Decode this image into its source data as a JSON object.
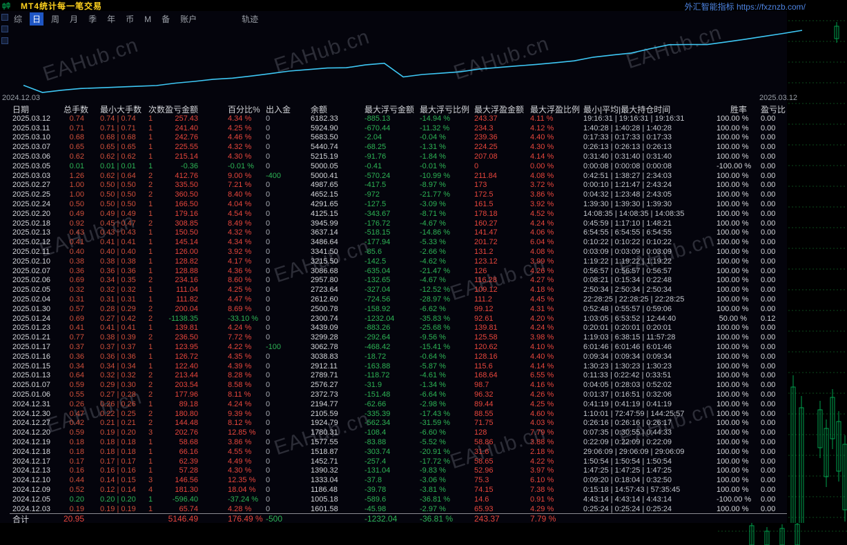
{
  "titlebar": {
    "title": "MT4统计每一笔交易",
    "right_text": "外汇智能指标 https://fxznzb.com/"
  },
  "menu": {
    "items": [
      "综",
      "日",
      "周",
      "月",
      "季",
      "年",
      "币",
      "M",
      "备",
      "账户",
      "轨迹"
    ],
    "active_index": 1
  },
  "watermark_text": "EAHub.cn",
  "equity_chart": {
    "start_date": "2024.12.03",
    "end_date": "2025.03.12"
  },
  "chart_data": {
    "type": "line",
    "title": "账户余额曲线",
    "line_color": "#3ec8f5",
    "x_range": [
      "2024.12.03",
      "2025.03.12"
    ],
    "ylim": [
      1005.18,
      6182.33
    ],
    "grid": false,
    "x": [
      "2024.12.03",
      "2024.12.05",
      "2024.12.09",
      "2024.12.10",
      "2024.12.13",
      "2024.12.17",
      "2024.12.18",
      "2024.12.19",
      "2024.12.20",
      "2024.12.27",
      "2024.12.30",
      "2024.12.31",
      "2025.01.06",
      "2025.01.07",
      "2025.01.13",
      "2025.01.15",
      "2025.01.16",
      "2025.01.17",
      "2025.01.21",
      "2025.01.23",
      "2025.01.24",
      "2025.01.30",
      "2025.02.04",
      "2025.02.05",
      "2025.02.06",
      "2025.02.07",
      "2025.02.10",
      "2025.02.11",
      "2025.02.12",
      "2025.02.13",
      "2025.02.18",
      "2025.02.20",
      "2025.02.24",
      "2025.02.25",
      "2025.02.27",
      "2025.03.03",
      "2025.03.05",
      "2025.03.06",
      "2025.03.07",
      "2025.03.10",
      "2025.03.11",
      "2025.03.12"
    ],
    "series": [
      {
        "name": "余额",
        "values": [
          1601.58,
          1005.18,
          1186.48,
          1333.04,
          1390.32,
          1452.71,
          1518.87,
          1577.55,
          1780.31,
          1924.79,
          2105.59,
          2194.77,
          2372.73,
          2576.27,
          2789.71,
          2912.11,
          3038.83,
          3062.78,
          3299.28,
          3439.09,
          2300.74,
          2500.78,
          2612.6,
          2723.64,
          2957.8,
          3086.68,
          3215.5,
          3341.5,
          3486.64,
          3637.14,
          3945.99,
          4125.15,
          4291.65,
          4652.15,
          4987.65,
          5000.41,
          5000.05,
          5215.19,
          5440.74,
          5683.5,
          5924.9,
          6182.33
        ]
      }
    ]
  },
  "table": {
    "headers": [
      "日期",
      "总手数",
      "最小大手数",
      "次数",
      "盈亏金额",
      "百分比%",
      "出入金",
      "余额",
      "最大浮亏金额",
      "最大浮亏比例",
      "最大浮盈金额",
      "最大浮盈比例",
      "最小|平均|最大持仓时间",
      "胜率",
      "盈亏比"
    ],
    "loss_days": [
      "2025.03.05",
      "2024.12.05"
    ],
    "rows": [
      [
        "2025.03.12",
        "0.74",
        "0.74 | 0.74",
        "1",
        "257.43",
        "4.34 %",
        "0",
        "6182.33",
        "-885.13",
        "-14.94 %",
        "243.37",
        "4.11 %",
        "19:16:31 | 19:16:31 | 19:16:31",
        "100.00 %",
        "0.00"
      ],
      [
        "2025.03.11",
        "0.71",
        "0.71 | 0.71",
        "1",
        "241.40",
        "4.25 %",
        "0",
        "5924.90",
        "-670.44",
        "-11.32 %",
        "234.3",
        "4.12 %",
        "1:40:28 | 1:40:28 | 1:40:28",
        "100.00 %",
        "0.00"
      ],
      [
        "2025.03.10",
        "0.68",
        "0.68 | 0.68",
        "1",
        "242.76",
        "4.46 %",
        "0",
        "5683.50",
        "-2.04",
        "-0.04 %",
        "239.36",
        "4.40 %",
        "0:17:33 | 0:17:33 | 0:17:33",
        "100.00 %",
        "0.00"
      ],
      [
        "2025.03.07",
        "0.65",
        "0.65 | 0.65",
        "1",
        "225.55",
        "4.32 %",
        "0",
        "5440.74",
        "-68.25",
        "-1.31 %",
        "224.25",
        "4.30 %",
        "0:26:13 | 0:26:13 | 0:26:13",
        "100.00 %",
        "0.00"
      ],
      [
        "2025.03.06",
        "0.62",
        "0.62 | 0.62",
        "1",
        "215.14",
        "4.30 %",
        "0",
        "5215.19",
        "-91.76",
        "-1.84 %",
        "207.08",
        "4.14 %",
        "0:31:40 | 0:31:40 | 0:31:40",
        "100.00 %",
        "0.00"
      ],
      [
        "2025.03.05",
        "0.01",
        "0.01 | 0.01",
        "1",
        "-0.36",
        "-0.01 %",
        "0",
        "5000.05",
        "-0.41",
        "-0.01 %",
        "0",
        "0.00 %",
        "0:00:08 | 0:00:08 | 0:00:08",
        "-100.00 %",
        "0.00"
      ],
      [
        "2025.03.03",
        "1.26",
        "0.62 | 0.64",
        "2",
        "412.76",
        "9.00 %",
        "-400",
        "5000.41",
        "-570.24",
        "-10.99 %",
        "211.84",
        "4.08 %",
        "0:42:51 | 1:38:27 | 2:34:03",
        "100.00 %",
        "0.00"
      ],
      [
        "2025.02.27",
        "1.00",
        "0.50 | 0.50",
        "2",
        "335.50",
        "7.21 %",
        "0",
        "4987.65",
        "-417.5",
        "-8.97 %",
        "173",
        "3.72 %",
        "0:00:10 | 1:21:47 | 2:43:24",
        "100.00 %",
        "0.00"
      ],
      [
        "2025.02.25",
        "1.00",
        "0.50 | 0.50",
        "2",
        "360.50",
        "8.40 %",
        "0",
        "4652.15",
        "-972",
        "-21.77 %",
        "172.5",
        "3.86 %",
        "0:04:32 | 1:23:48 | 2:43:05",
        "100.00 %",
        "0.00"
      ],
      [
        "2025.02.24",
        "0.50",
        "0.50 | 0.50",
        "1",
        "166.50",
        "4.04 %",
        "0",
        "4291.65",
        "-127.5",
        "-3.09 %",
        "161.5",
        "3.92 %",
        "1:39:30 | 1:39:30 | 1:39:30",
        "100.00 %",
        "0.00"
      ],
      [
        "2025.02.20",
        "0.49",
        "0.49 | 0.49",
        "1",
        "179.16",
        "4.54 %",
        "0",
        "4125.15",
        "-343.67",
        "-8.71 %",
        "178.18",
        "4.52 %",
        "14:08:35 | 14:08:35 | 14:08:35",
        "100.00 %",
        "0.00"
      ],
      [
        "2025.02.18",
        "0.92",
        "0.45 | 0.47",
        "2",
        "308.85",
        "8.49 %",
        "0",
        "3945.99",
        "-176.72",
        "-4.67 %",
        "160.27",
        "4.24 %",
        "0:45:59 | 1:17:10 | 1:48:21",
        "100.00 %",
        "0.00"
      ],
      [
        "2025.02.13",
        "0.43",
        "0.43 | 0.43",
        "1",
        "150.50",
        "4.32 %",
        "0",
        "3637.14",
        "-518.15",
        "-14.86 %",
        "141.47",
        "4.06 %",
        "6:54:55 | 6:54:55 | 6:54:55",
        "100.00 %",
        "0.00"
      ],
      [
        "2025.02.12",
        "0.41",
        "0.41 | 0.41",
        "1",
        "145.14",
        "4.34 %",
        "0",
        "3486.64",
        "-177.94",
        "-5.33 %",
        "201.72",
        "6.04 %",
        "0:10:22 | 0:10:22 | 0:10:22",
        "100.00 %",
        "0.00"
      ],
      [
        "2025.02.11",
        "0.40",
        "0.40 | 0.40",
        "1",
        "126.00",
        "3.92 %",
        "0",
        "3341.50",
        "-85.6",
        "-2.66 %",
        "131.2",
        "4.08 %",
        "0:03:09 | 0:03:09 | 0:03:09",
        "100.00 %",
        "0.00"
      ],
      [
        "2025.02.10",
        "0.38",
        "0.38 | 0.38",
        "1",
        "128.82",
        "4.17 %",
        "0",
        "3215.50",
        "-142.5",
        "-4.62 %",
        "123.12",
        "3.99 %",
        "1:19:22 | 1:19:22 | 1:19:22",
        "100.00 %",
        "0.00"
      ],
      [
        "2025.02.07",
        "0.36",
        "0.36 | 0.36",
        "1",
        "128.88",
        "4.36 %",
        "0",
        "3086.68",
        "-635.04",
        "-21.47 %",
        "126",
        "4.26 %",
        "0:56:57 | 0:56:57 | 0:56:57",
        "100.00 %",
        "0.00"
      ],
      [
        "2025.02.06",
        "0.69",
        "0.34 | 0.35",
        "2",
        "234.16",
        "8.60 %",
        "0",
        "2957.80",
        "-132.65",
        "-4.67 %",
        "116.28",
        "4.27 %",
        "0:08:21 | 0:15:34 | 0:22:48",
        "100.00 %",
        "0.00"
      ],
      [
        "2025.02.05",
        "0.32",
        "0.32 | 0.32",
        "1",
        "111.04",
        "4.25 %",
        "0",
        "2723.64",
        "-327.04",
        "-12.52 %",
        "109.12",
        "4.18 %",
        "2:50:34 | 2:50:34 | 2:50:34",
        "100.00 %",
        "0.00"
      ],
      [
        "2025.02.04",
        "0.31",
        "0.31 | 0.31",
        "1",
        "111.82",
        "4.47 %",
        "0",
        "2612.60",
        "-724.56",
        "-28.97 %",
        "111.2",
        "4.45 %",
        "22:28:25 | 22:28:25 | 22:28:25",
        "100.00 %",
        "0.00"
      ],
      [
        "2025.01.30",
        "0.57",
        "0.28 | 0.29",
        "2",
        "200.04",
        "8.69 %",
        "0",
        "2500.78",
        "-158.92",
        "-6.62 %",
        "99.12",
        "4.31 %",
        "0:52:48 | 0:55:57 | 0:59:06",
        "100.00 %",
        "0.00"
      ],
      [
        "2025.01.24",
        "0.69",
        "0.27 | 0.42",
        "2",
        "-1138.35",
        "-33.10 %",
        "0",
        "2300.74",
        "-1232.04",
        "-35.83 %",
        "92.61",
        "4.20 %",
        "1:03:05 | 6:53:52 | 12:44:40",
        "50.00 %",
        "0.12"
      ],
      [
        "2025.01.23",
        "0.41",
        "0.41 | 0.41",
        "1",
        "139.81",
        "4.24 %",
        "0",
        "3439.09",
        "-883.26",
        "-25.68 %",
        "139.81",
        "4.24 %",
        "0:20:01 | 0:20:01 | 0:20:01",
        "100.00 %",
        "0.00"
      ],
      [
        "2025.01.21",
        "0.77",
        "0.38 | 0.39",
        "2",
        "236.50",
        "7.72 %",
        "0",
        "3299.28",
        "-292.64",
        "-9.56 %",
        "125.58",
        "3.98 %",
        "1:19:03 | 6:38:15 | 11:57:28",
        "100.00 %",
        "0.00"
      ],
      [
        "2025.01.17",
        "0.37",
        "0.37 | 0.37",
        "1",
        "123.95",
        "4.22 %",
        "-100",
        "3062.78",
        "-468.42",
        "-15.41 %",
        "120.62",
        "4.10 %",
        "6:01:46 | 6:01:46 | 6:01:46",
        "100.00 %",
        "0.00"
      ],
      [
        "2025.01.16",
        "0.36",
        "0.36 | 0.36",
        "1",
        "126.72",
        "4.35 %",
        "0",
        "3038.83",
        "-18.72",
        "-0.64 %",
        "128.16",
        "4.40 %",
        "0:09:34 | 0:09:34 | 0:09:34",
        "100.00 %",
        "0.00"
      ],
      [
        "2025.01.15",
        "0.34",
        "0.34 | 0.34",
        "1",
        "122.40",
        "4.39 %",
        "0",
        "2912.11",
        "-163.88",
        "-5.87 %",
        "115.6",
        "4.14 %",
        "1:30:23 | 1:30:23 | 1:30:23",
        "100.00 %",
        "0.00"
      ],
      [
        "2025.01.13",
        "0.64",
        "0.32 | 0.32",
        "2",
        "213.44",
        "8.28 %",
        "0",
        "2789.71",
        "-118.72",
        "-4.61 %",
        "168.64",
        "6.55 %",
        "0:11:33 | 0:22:42 | 0:33:51",
        "100.00 %",
        "0.00"
      ],
      [
        "2025.01.07",
        "0.59",
        "0.29 | 0.30",
        "2",
        "203.54",
        "8.58 %",
        "0",
        "2576.27",
        "-31.9",
        "-1.34 %",
        "98.7",
        "4.16 %",
        "0:04:05 | 0:28:03 | 0:52:02",
        "100.00 %",
        "0.00"
      ],
      [
        "2025.01.06",
        "0.55",
        "0.27 | 0.28",
        "2",
        "177.96",
        "8.11 %",
        "0",
        "2372.73",
        "-151.48",
        "-6.64 %",
        "96.32",
        "4.26 %",
        "0:01:37 | 0:16:51 | 0:32:06",
        "100.00 %",
        "0.00"
      ],
      [
        "2024.12.31",
        "0.26",
        "0.26 | 0.26",
        "1",
        "89.18",
        "4.24 %",
        "0",
        "2194.77",
        "-62.66",
        "-2.98 %",
        "89.44",
        "4.25 %",
        "0:41:19 | 0:41:19 | 0:41:19",
        "100.00 %",
        "0.00"
      ],
      [
        "2024.12.30",
        "0.47",
        "0.22 | 0.25",
        "2",
        "180.80",
        "9.39 %",
        "0",
        "2105.59",
        "-335.39",
        "-17.43 %",
        "88.55",
        "4.60 %",
        "1:10:01 | 72:47:59 | 144:25:57",
        "100.00 %",
        "0.00"
      ],
      [
        "2024.12.27",
        "0.42",
        "0.21 | 0.21",
        "2",
        "144.48",
        "8.12 %",
        "0",
        "1924.79",
        "-562.34",
        "-31.59 %",
        "71.75",
        "4.03 %",
        "0:26:16 | 0:26:16 | 0:26:17",
        "100.00 %",
        "0.00"
      ],
      [
        "2024.12.20",
        "0.59",
        "0.19 | 0.20",
        "3",
        "202.76",
        "12.85 %",
        "0",
        "1780.31",
        "-108.4",
        "-6.60 %",
        "128",
        "7.79 %",
        "0:07:35 | 0:30:55 | 0:44:33",
        "100.00 %",
        "0.00"
      ],
      [
        "2024.12.19",
        "0.18",
        "0.18 | 0.18",
        "1",
        "58.68",
        "3.86 %",
        "0",
        "1577.55",
        "-83.88",
        "-5.52 %",
        "58.86",
        "3.88 %",
        "0:22:09 | 0:22:09 | 0:22:09",
        "100.00 %",
        "0.00"
      ],
      [
        "2024.12.18",
        "0.18",
        "0.18 | 0.18",
        "1",
        "66.16",
        "4.55 %",
        "0",
        "1518.87",
        "-303.74",
        "-20.91 %",
        "31.6",
        "2.18 %",
        "29:06:09 | 29:06:09 | 29:06:09",
        "100.00 %",
        "0.00"
      ],
      [
        "2024.12.17",
        "0.17",
        "0.17 | 0.17",
        "1",
        "62.39",
        "4.49 %",
        "0",
        "1452.71",
        "-257.4",
        "-17.72 %",
        "58.65",
        "4.22 %",
        "1:50:54 | 1:50:54 | 1:50:54",
        "100.00 %",
        "0.00"
      ],
      [
        "2024.12.13",
        "0.16",
        "0.16 | 0.16",
        "1",
        "57.28",
        "4.30 %",
        "0",
        "1390.32",
        "-131.04",
        "-9.83 %",
        "52.96",
        "3.97 %",
        "1:47:25 | 1:47:25 | 1:47:25",
        "100.00 %",
        "0.00"
      ],
      [
        "2024.12.10",
        "0.44",
        "0.14 | 0.15",
        "3",
        "146.56",
        "12.35 %",
        "0",
        "1333.04",
        "-37.8",
        "-3.06 %",
        "75.3",
        "6.10 %",
        "0:09:20 | 0:18:04 | 0:32:50",
        "100.00 %",
        "0.00"
      ],
      [
        "2024.12.09",
        "0.52",
        "0.12 | 0.14",
        "4",
        "181.30",
        "18.04 %",
        "0",
        "1186.48",
        "-39.78",
        "-3.81 %",
        "74.15",
        "7.38 %",
        "0:15:18 | 14:57:43 | 57:35:45",
        "100.00 %",
        "0.00"
      ],
      [
        "2024.12.05",
        "0.20",
        "0.20 | 0.20",
        "1",
        "-596.40",
        "-37.24 %",
        "0",
        "1005.18",
        "-589.6",
        "-36.81 %",
        "14.6",
        "0.91 %",
        "4:43:14 | 4:43:14 | 4:43:14",
        "-100.00 %",
        "0.00"
      ],
      [
        "2024.12.03",
        "0.19",
        "0.19 | 0.19",
        "1",
        "65.74",
        "4.28 %",
        "0",
        "1601.58",
        "-45.98",
        "-2.97 %",
        "65.93",
        "4.29 %",
        "0:25:24 | 0:25:24 | 0:25:24",
        "100.00 %",
        "0.00"
      ]
    ],
    "footer": {
      "label": "合计",
      "total_lots": "20.95",
      "total_pnl": "5146.49",
      "total_pct": "176.49 %",
      "total_flow": "-500",
      "max_float_loss": "-1232.04",
      "max_float_loss_pct": "-36.81 %",
      "max_float_profit": "243.37",
      "max_float_profit_pct": "7.79 %"
    }
  }
}
